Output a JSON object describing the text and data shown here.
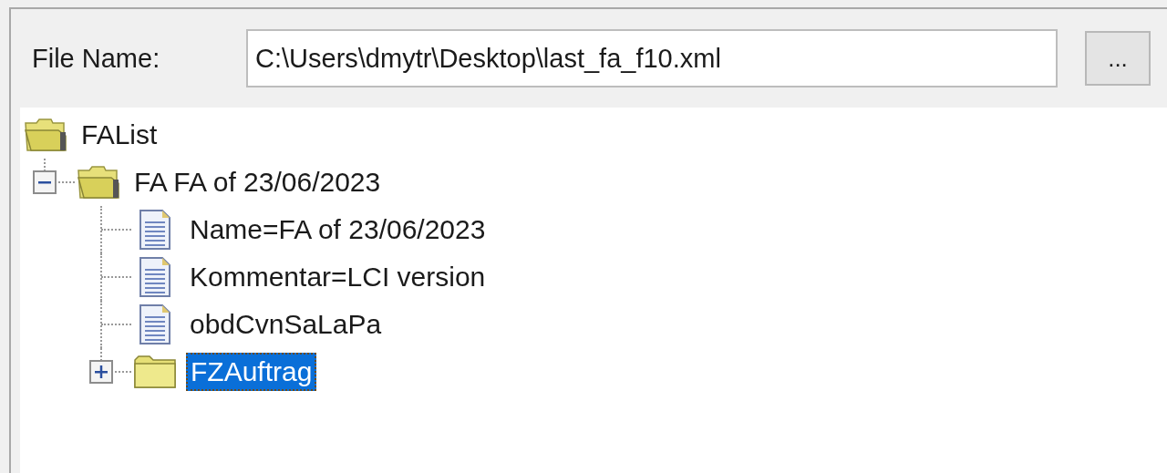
{
  "file_name": {
    "label": "File Name:",
    "value": "C:\\Users\\dmytr\\Desktop\\last_fa_f10.xml"
  },
  "browse_button": {
    "label": "..."
  },
  "tree": [
    {
      "label": "FAList",
      "kind": "folder",
      "expanded": true,
      "selected": false,
      "children": [
        {
          "label": "FA FA of 23/06/2023",
          "kind": "folder",
          "expanded": true,
          "selected": false,
          "children": [
            {
              "label": "Name=FA of 23/06/2023",
              "kind": "document",
              "selected": false
            },
            {
              "label": "Kommentar=LCI version",
              "kind": "document",
              "selected": false
            },
            {
              "label": "obdCvnSaLaPa",
              "kind": "document",
              "selected": false
            },
            {
              "label": "FZAuftrag",
              "kind": "folder",
              "expanded": false,
              "selected": true
            }
          ]
        }
      ]
    }
  ]
}
